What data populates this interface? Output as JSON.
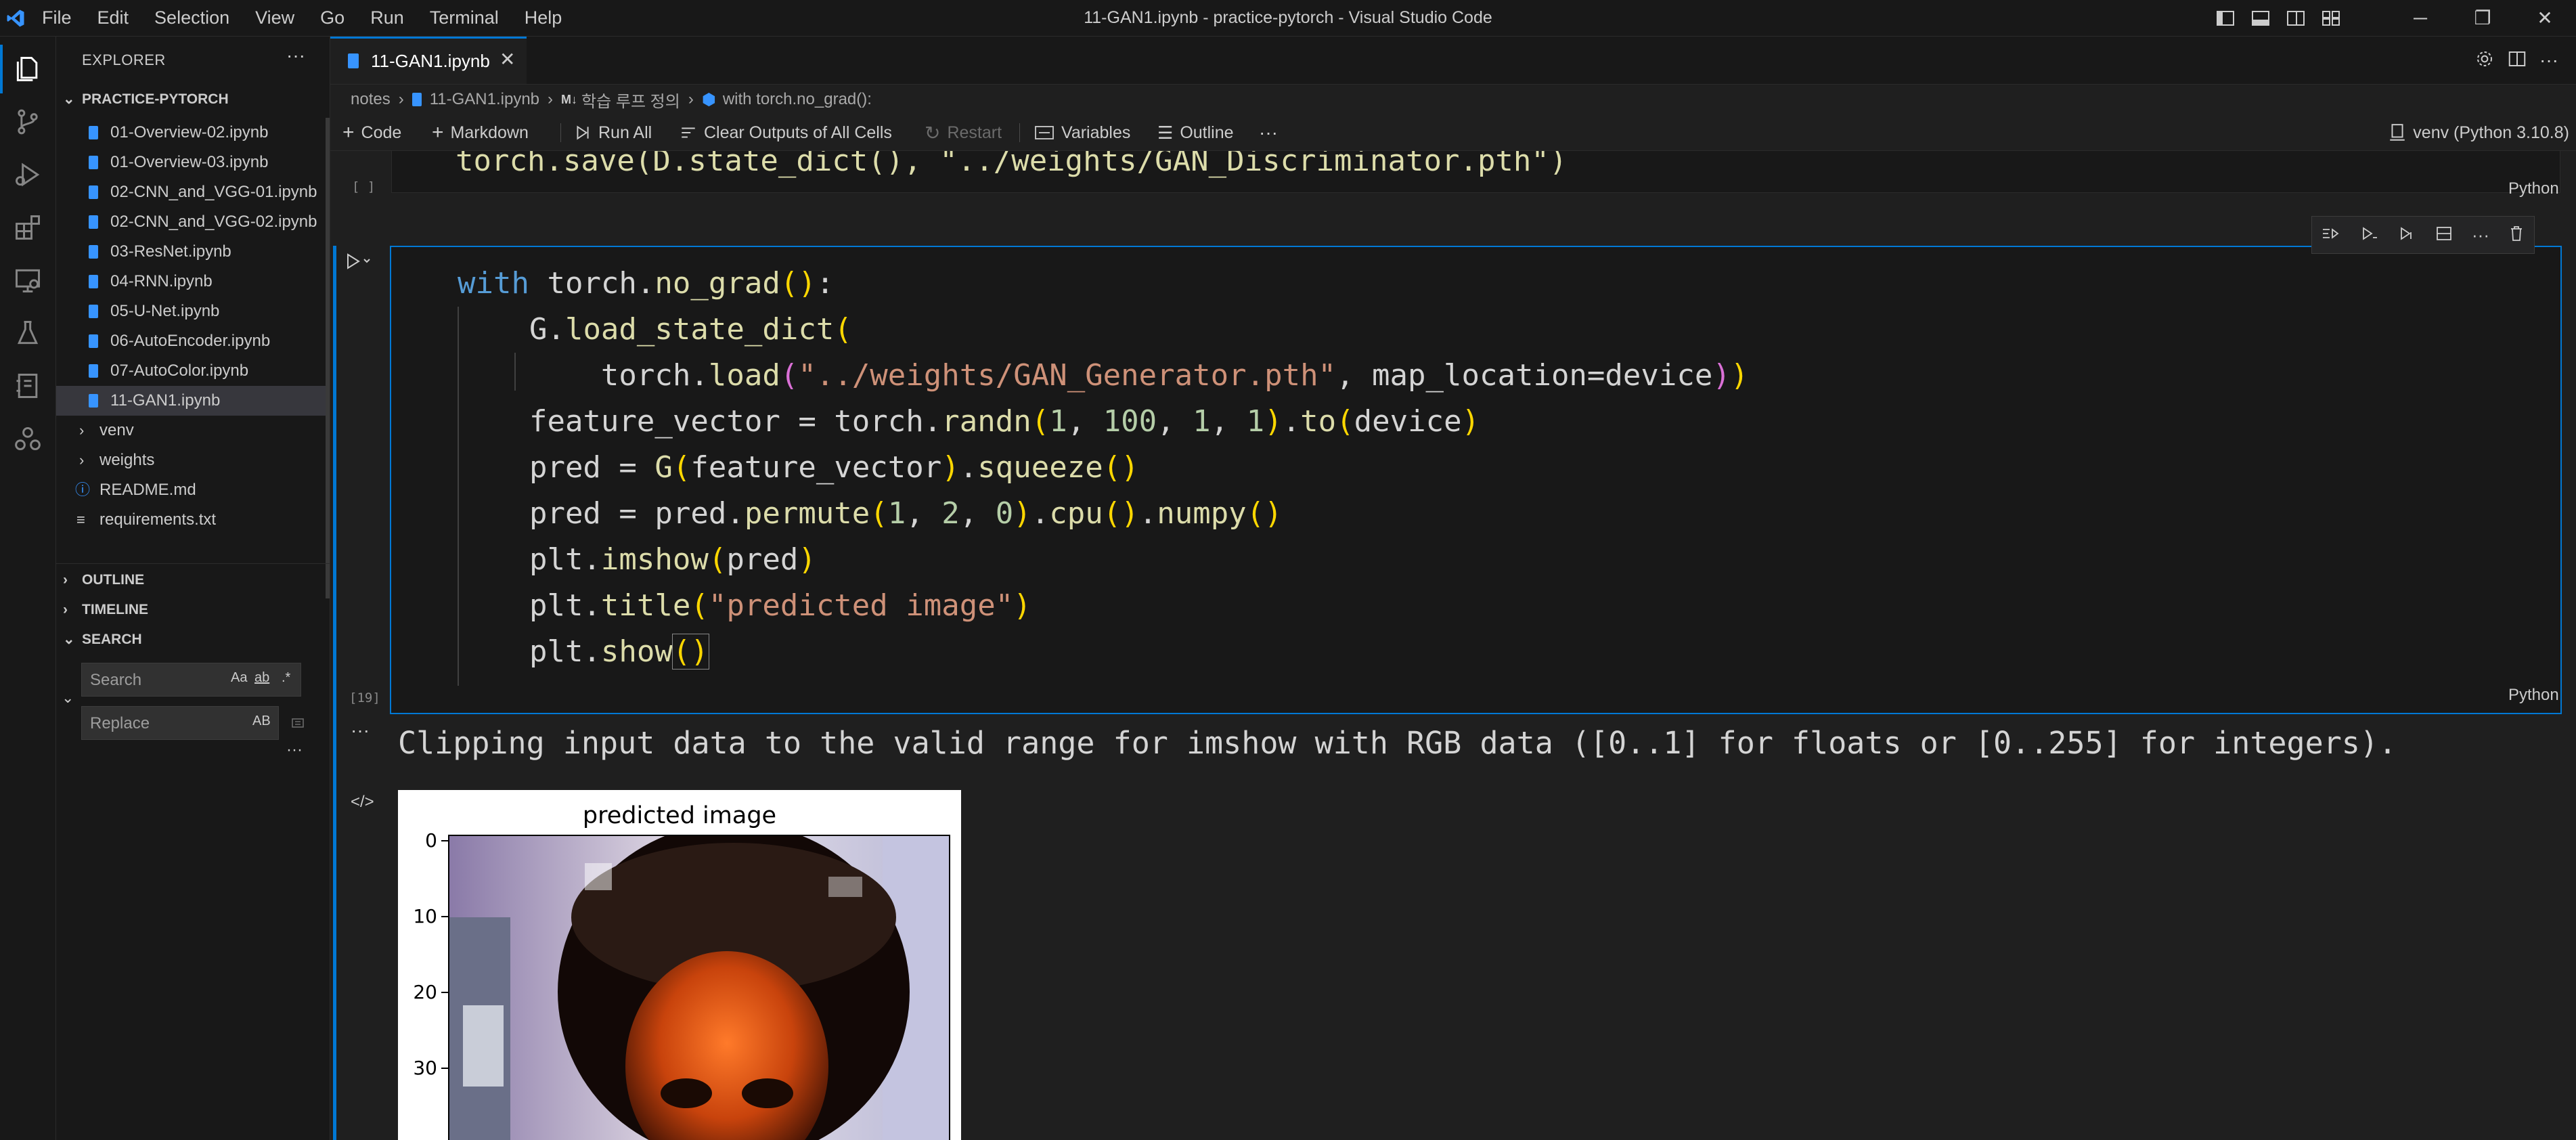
{
  "window": {
    "title": "11-GAN1.ipynb - practice-pytorch - Visual Studio Code",
    "menu": [
      "File",
      "Edit",
      "Selection",
      "View",
      "Go",
      "Run",
      "Terminal",
      "Help"
    ]
  },
  "sidebar": {
    "header": "EXPLORER",
    "more": "···",
    "project": "PRACTICE-PYTORCH",
    "files": [
      {
        "name": "01-Overview-02.ipynb",
        "kind": "notebook"
      },
      {
        "name": "01-Overview-03.ipynb",
        "kind": "notebook"
      },
      {
        "name": "02-CNN_and_VGG-01.ipynb",
        "kind": "notebook"
      },
      {
        "name": "02-CNN_and_VGG-02.ipynb",
        "kind": "notebook"
      },
      {
        "name": "03-ResNet.ipynb",
        "kind": "notebook"
      },
      {
        "name": "04-RNN.ipynb",
        "kind": "notebook"
      },
      {
        "name": "05-U-Net.ipynb",
        "kind": "notebook"
      },
      {
        "name": "06-AutoEncoder.ipynb",
        "kind": "notebook"
      },
      {
        "name": "07-AutoColor.ipynb",
        "kind": "notebook"
      },
      {
        "name": "11-GAN1.ipynb",
        "kind": "notebook",
        "selected": true
      }
    ],
    "folders": [
      "venv",
      "weights"
    ],
    "root_files": [
      "README.md",
      "requirements.txt"
    ],
    "sections": {
      "outline": "OUTLINE",
      "timeline": "TIMELINE",
      "search": "SEARCH"
    },
    "search": {
      "placeholder": "Search",
      "replace_placeholder": "Replace",
      "opt_case": "Aa",
      "opt_word": "ab",
      "opt_regex": ".*",
      "opt_preserve": "AB",
      "more": "···"
    }
  },
  "tab": {
    "label": "11-GAN1.ipynb",
    "close": "✕"
  },
  "breadcrumb": {
    "items": [
      "notes",
      "11-GAN1.ipynb",
      "학습 루프 정의",
      "with torch.no_grad():"
    ],
    "md_badge": "M↓"
  },
  "notebook_toolbar": {
    "code": "Code",
    "markdown": "Markdown",
    "run_all": "Run All",
    "clear_outputs": "Clear Outputs of All Cells",
    "restart": "Restart",
    "variables": "Variables",
    "outline": "Outline",
    "more": "···",
    "kernel": "venv (Python 3.10.8)"
  },
  "prev_cell": {
    "code": "torch.save(D.state_dict(), \"../weights/GAN_Discriminator.pth\")",
    "exec": "[ ]",
    "lang": "Python"
  },
  "active_cell": {
    "exec": "[19]",
    "lang": "Python",
    "lines": [
      "with torch.no_grad():",
      "    G.load_state_dict(",
      "        torch.load(\"../weights/GAN_Generator.pth\", map_location=device))",
      "    feature_vector = torch.randn(1, 100, 1, 1).to(device)",
      "    pred = G(feature_vector).squeeze()",
      "    pred = pred.permute(1, 2, 0).cpu().numpy()",
      "    plt.imshow(pred)",
      "    plt.title(\"predicted image\")",
      "    plt.show()"
    ]
  },
  "output": {
    "more": "···",
    "message": "Clipping input data to the valid range for imshow with RGB data ([0..1] for floats or [0..255] for integers).",
    "figure": {
      "title": "predicted image",
      "yticks": [
        "0",
        "10",
        "20",
        "30"
      ]
    }
  },
  "colors": {
    "accent": "#0078d4",
    "keyword": "#569cd6",
    "function": "#dcdcaa",
    "string": "#ce9178",
    "number": "#b5cea8"
  }
}
